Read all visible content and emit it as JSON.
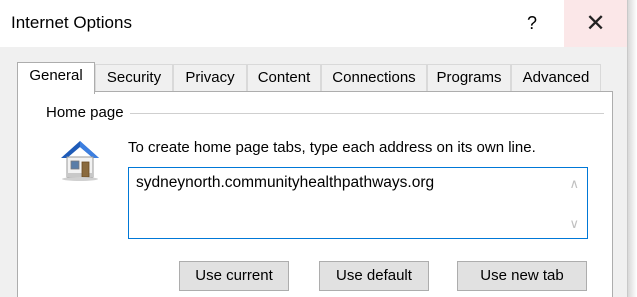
{
  "window": {
    "title": "Internet Options",
    "help_label": "?",
    "close_label": "✕"
  },
  "tabs": [
    {
      "label": "General",
      "active": true
    },
    {
      "label": "Security"
    },
    {
      "label": "Privacy"
    },
    {
      "label": "Content"
    },
    {
      "label": "Connections"
    },
    {
      "label": "Programs"
    },
    {
      "label": "Advanced"
    }
  ],
  "home_page": {
    "group_label": "Home page",
    "instructions": "To create home page tabs, type each address on its own line.",
    "url_value": "sydneynorth.communityhealthpathways.org",
    "icon": "house-icon",
    "buttons": {
      "use_current": "Use current",
      "use_default": "Use default",
      "use_new_tab": "Use new tab"
    }
  },
  "colors": {
    "focus_border": "#0078d7",
    "close_hover": "#fbe7e8",
    "house_roof": "#1e5bb8"
  }
}
